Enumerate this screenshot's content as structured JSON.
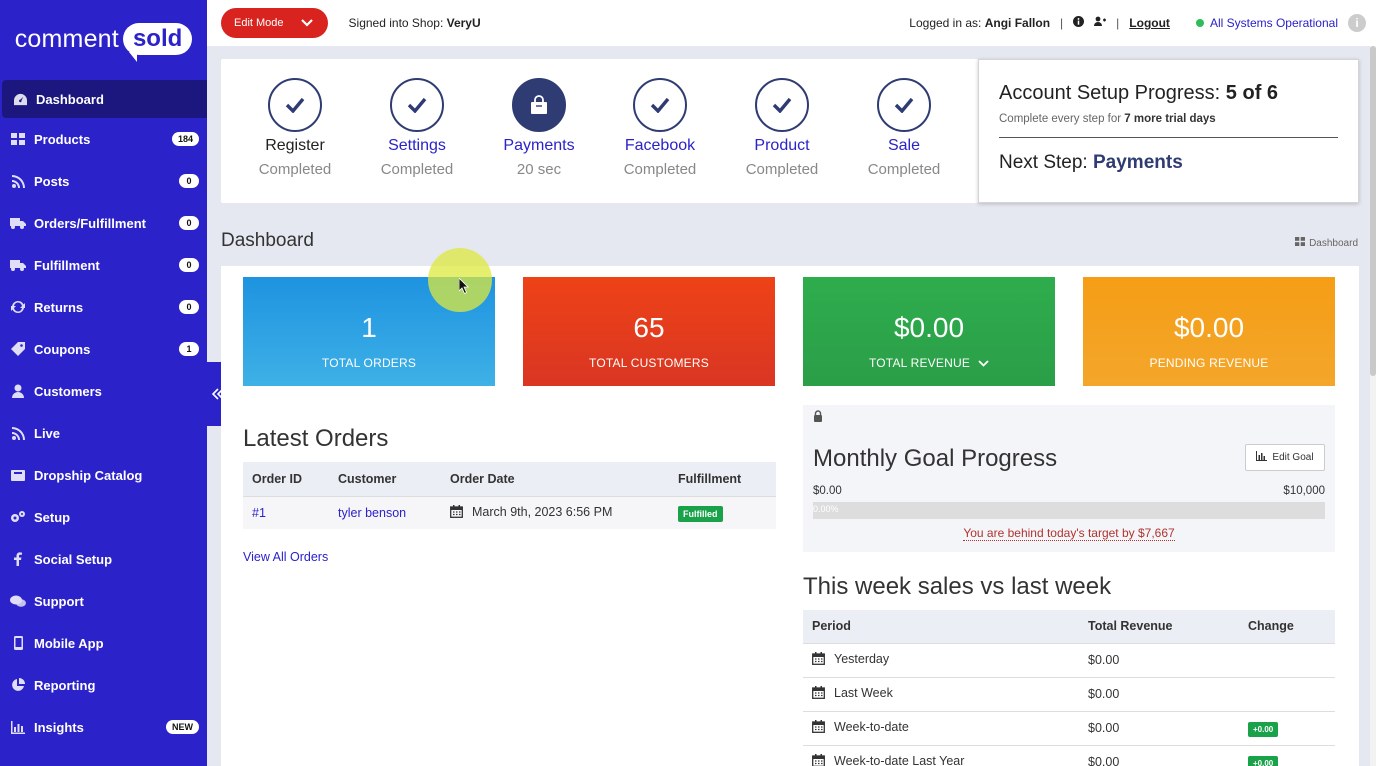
{
  "brand": {
    "word": "comment",
    "bubble": "sold",
    "color": "#2b22c9"
  },
  "sidebar": {
    "items": [
      {
        "label": "Dashboard",
        "icon": "gauge-icon",
        "badge": ""
      },
      {
        "label": "Products",
        "icon": "grid-icon",
        "badge": "184"
      },
      {
        "label": "Posts",
        "icon": "rss-icon",
        "badge": "0"
      },
      {
        "label": "Orders/Fulfillment",
        "icon": "truck-icon",
        "badge": "0"
      },
      {
        "label": "Fulfillment",
        "icon": "truck-icon",
        "badge": "0"
      },
      {
        "label": "Returns",
        "icon": "refresh-icon",
        "badge": "0"
      },
      {
        "label": "Coupons",
        "icon": "tag-icon",
        "badge": "1"
      },
      {
        "label": "Customers",
        "icon": "user-icon",
        "badge": ""
      },
      {
        "label": "Live",
        "icon": "rss-icon",
        "badge": ""
      },
      {
        "label": "Dropship Catalog",
        "icon": "box-icon",
        "badge": ""
      },
      {
        "label": "Setup",
        "icon": "gears-icon",
        "badge": ""
      },
      {
        "label": "Social Setup",
        "icon": "facebook-icon",
        "badge": ""
      },
      {
        "label": "Support",
        "icon": "chat-icon",
        "badge": ""
      },
      {
        "label": "Mobile App",
        "icon": "mobile-icon",
        "badge": ""
      },
      {
        "label": "Reporting",
        "icon": "pie-chart-icon",
        "badge": ""
      },
      {
        "label": "Insights",
        "icon": "bar-chart-icon",
        "badge": "NEW"
      }
    ]
  },
  "topbar": {
    "edit_mode": "Edit Mode",
    "signed_prefix": "Signed into Shop: ",
    "shop": "VeryU",
    "logged_prefix": "Logged in as: ",
    "user": "Angi Fallon",
    "sep": "|",
    "logout": "Logout",
    "status": "All Systems Operational"
  },
  "steps": [
    {
      "name": "Register",
      "status": "Completed"
    },
    {
      "name": "Settings",
      "status": "Completed"
    },
    {
      "name": "Payments",
      "status": "20 sec"
    },
    {
      "name": "Facebook",
      "status": "Completed"
    },
    {
      "name": "Product",
      "status": "Completed"
    },
    {
      "name": "Sale",
      "status": "Completed"
    }
  ],
  "setup": {
    "title": "Account Setup Progress: ",
    "count": "5 of 6",
    "sub_prefix": "Complete every step for ",
    "sub_bold": "7 more trial days",
    "next_label": "Next Step: ",
    "next_value": "Payments"
  },
  "page": {
    "title": "Dashboard",
    "crumb": "Dashboard"
  },
  "tiles": [
    {
      "value": "1",
      "label": "TOTAL ORDERS"
    },
    {
      "value": "65",
      "label": "TOTAL CUSTOMERS"
    },
    {
      "value": "$0.00",
      "label": "TOTAL REVENUE"
    },
    {
      "value": "$0.00",
      "label": "PENDING REVENUE"
    }
  ],
  "latest_orders": {
    "title": "Latest Orders",
    "headers": [
      "Order ID",
      "Customer",
      "Order Date",
      "Fulfillment"
    ],
    "rows": [
      {
        "id": "#1",
        "customer": "tyler benson",
        "date": "March 9th, 2023 6:56 PM",
        "fulfillment": "Fulfilled"
      }
    ],
    "view_all": "View All Orders"
  },
  "goal": {
    "title": "Monthly Goal Progress",
    "edit": "Edit Goal",
    "min": "$0.00",
    "max": "$10,000",
    "bar_text": "0.00%",
    "progress": 0,
    "message": "You are behind today's target by $7,667"
  },
  "week_sales": {
    "title": "This week sales vs last week",
    "headers": [
      "Period",
      "Total Revenue",
      "Change"
    ],
    "rows": [
      {
        "period": "Yesterday",
        "revenue": "$0.00",
        "change": ""
      },
      {
        "period": "Last Week",
        "revenue": "$0.00",
        "change": ""
      },
      {
        "period": "Week-to-date",
        "revenue": "$0.00",
        "change": "+0.00"
      },
      {
        "period": "Week-to-date Last Year",
        "revenue": "$0.00",
        "change": "+0.00"
      }
    ]
  }
}
